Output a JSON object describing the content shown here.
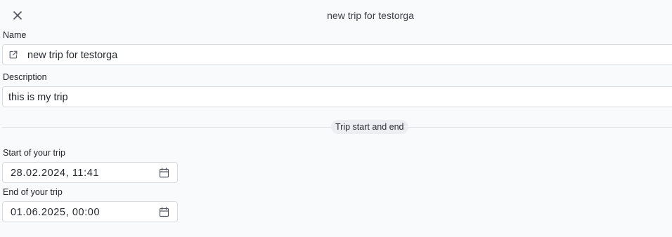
{
  "header": {
    "close_icon": "close-icon",
    "title": "new trip for testorga"
  },
  "form": {
    "name": {
      "label": "Name",
      "value": "new trip for testorga",
      "icon": "external-link-icon"
    },
    "description": {
      "label": "Description",
      "value": "this is my trip"
    },
    "section_divider": {
      "label": "Trip start and end"
    },
    "start": {
      "label": "Start of your trip",
      "value": "28.02.2024, 11:41",
      "icon": "calendar-icon"
    },
    "end": {
      "label": "End of your trip",
      "value": "01.06.2025, 00:00",
      "icon": "calendar-icon"
    }
  },
  "colors": {
    "background": "#f9fafc",
    "field_border": "#d6d9de",
    "divider_chip": "#eceef1"
  }
}
